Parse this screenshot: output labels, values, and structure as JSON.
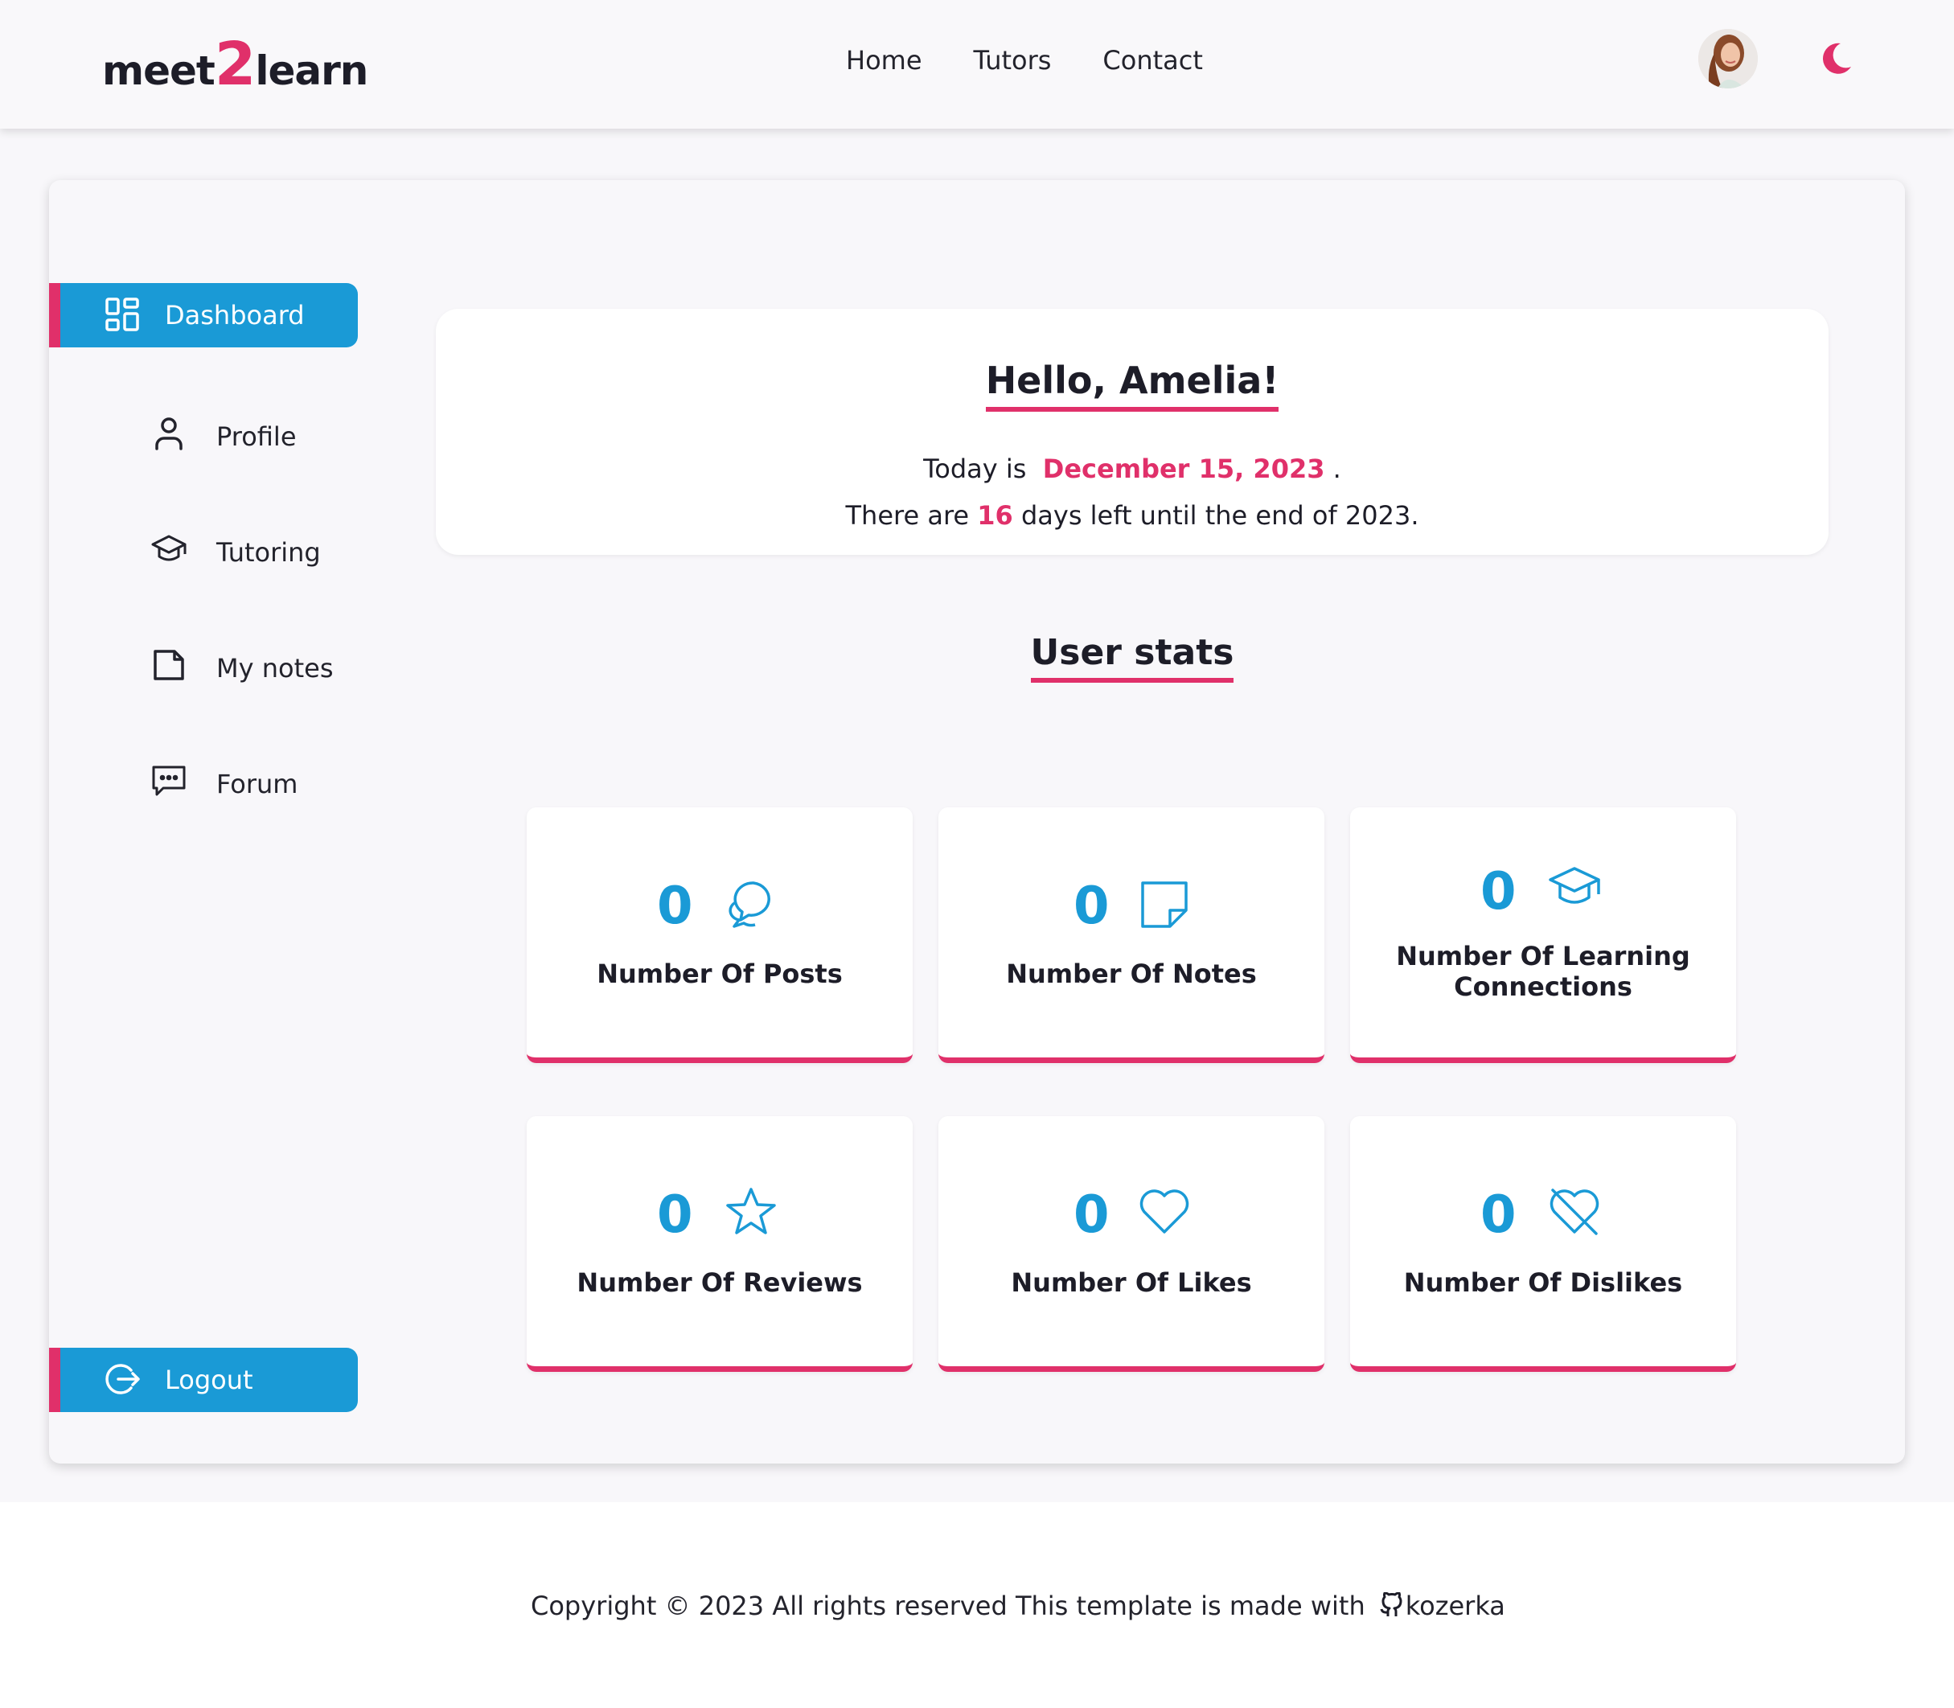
{
  "header": {
    "logo_prefix": "meet",
    "logo_two": "2",
    "logo_suffix": "learn",
    "nav": [
      "Home",
      "Tutors",
      "Contact"
    ]
  },
  "sidebar": {
    "items": [
      {
        "label": "Dashboard",
        "icon": "dashboard-icon",
        "active": true
      },
      {
        "label": "Profile",
        "icon": "user-icon"
      },
      {
        "label": "Tutoring",
        "icon": "graduation-cap-icon"
      },
      {
        "label": "My notes",
        "icon": "note-icon"
      },
      {
        "label": "Forum",
        "icon": "chat-icon"
      }
    ],
    "logout": "Logout"
  },
  "greeting": {
    "title": "Hello, Amelia!",
    "today_prefix": "Today is",
    "date": "December 15, 2023",
    "today_suffix": ".",
    "days_prefix": "There are",
    "days_left": "16",
    "days_suffix": "days left until the end of 2023."
  },
  "stats": {
    "title": "User stats",
    "cards": [
      {
        "value": "0",
        "label": "Number Of Posts",
        "icon": "chat-bubbles-icon"
      },
      {
        "value": "0",
        "label": "Number Of Notes",
        "icon": "note-icon"
      },
      {
        "value": "0",
        "label": "Number Of Learning Connections",
        "icon": "graduation-cap-icon"
      },
      {
        "value": "0",
        "label": "Number Of Reviews",
        "icon": "star-icon"
      },
      {
        "value": "0",
        "label": "Number Of Likes",
        "icon": "heart-icon"
      },
      {
        "value": "0",
        "label": "Number Of Dislikes",
        "icon": "heart-off-icon"
      }
    ]
  },
  "footer": {
    "text": "Copyright © 2023 All rights reserved This template is made with",
    "author": "kozerka"
  },
  "colors": {
    "accent": "#1a9ad6",
    "brand_pink": "#e0306a",
    "text": "#1d1d28",
    "background": "#f8f7fa"
  }
}
